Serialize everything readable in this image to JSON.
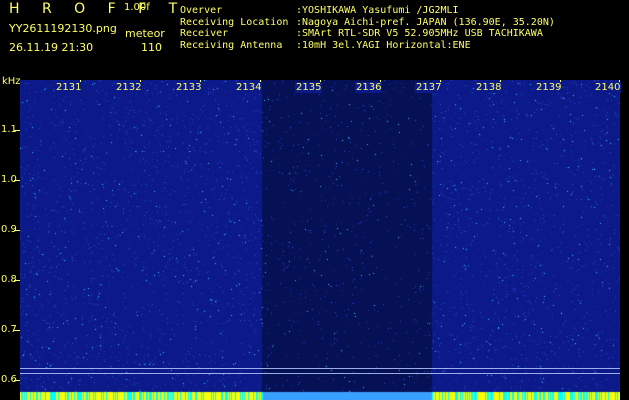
{
  "app": {
    "brand": "H R O F F T",
    "version": "1.00f",
    "filename": "YY2611192130.png",
    "mode": "meteor",
    "datetime": "26.11.19 21:30",
    "count": "110"
  },
  "meta": [
    {
      "key": "Overver",
      "value": ":YOSHIKAWA Yasufumi /JG2MLI"
    },
    {
      "key": "Receiving Location",
      "value": ":Nagoya Aichi-pref. JAPAN (136.90E, 35.20N)"
    },
    {
      "key": "Receiver",
      "value": ":SMArt RTL-SDR V5 52.905MHz USB TACHIKAWA"
    },
    {
      "key": "Receiving Antenna",
      "value": ":10mH 3el.YAGI Horizontal:ENE"
    }
  ],
  "chart_data": {
    "type": "heatmap",
    "ylabel": "kHz",
    "y_ticks": [
      "1.1",
      "1.0",
      "0.9",
      "0.8",
      "0.7",
      "0.6"
    ],
    "x_ticks": [
      "2131",
      "2132",
      "2133",
      "2134",
      "2135",
      "2136",
      "2137",
      "2138",
      "2139",
      "2140"
    ],
    "colors": {
      "background": "#0b1a88",
      "dark_band": "#061055",
      "speckle": "#39c7ff",
      "bottom_bar": "#ffff00"
    }
  }
}
